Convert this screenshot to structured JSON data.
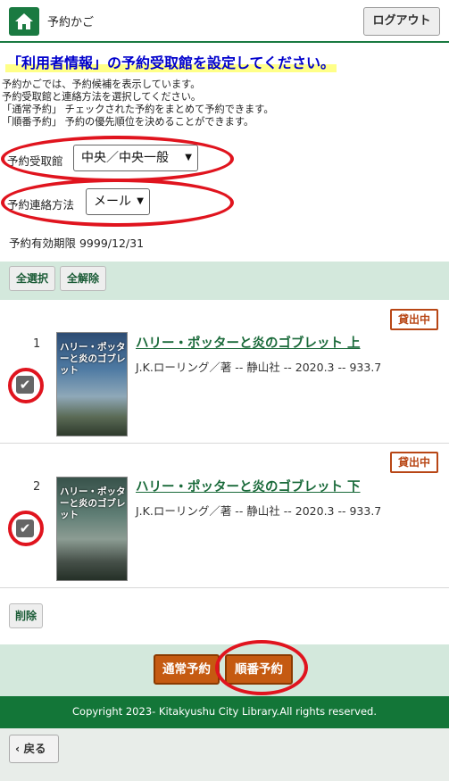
{
  "header": {
    "title": "予約かご",
    "logout_label": "ログアウト",
    "home_icon": "home-icon"
  },
  "notice": "「利用者情報」の予約受取館を設定してください。",
  "help_lines": [
    "予約かごでは、予約候補を表示しています。",
    "予約受取館と連絡方法を選択してください。",
    "「通常予約」 チェックされた予約をまとめて予約できます。",
    "「順番予約」 予約の優先順位を決めることができます。"
  ],
  "form": {
    "pickup_label": "予約受取館",
    "pickup_value": "中央／中央一般",
    "contact_label": "予約連絡方法",
    "contact_value": "メール",
    "expiry": "予約有効期限 9999/12/31"
  },
  "selection": {
    "select_all": "全選択",
    "deselect_all": "全解除"
  },
  "items": [
    {
      "num": "1",
      "title": "ハリー・ポッターと炎のゴブレット 上",
      "meta": "J.K.ローリング／著 -- 静山社 -- 2020.3 -- 933.7",
      "status": "貸出中",
      "checked": true,
      "cover_text": "ハリー・ポッターと炎のゴブレット"
    },
    {
      "num": "2",
      "title": "ハリー・ポッターと炎のゴブレット 下",
      "meta": "J.K.ローリング／著 -- 静山社 -- 2020.3 -- 933.7",
      "status": "貸出中",
      "checked": true,
      "cover_text": "ハリー・ポッターと炎のゴブレット"
    }
  ],
  "delete_label": "削除",
  "actions": {
    "normal_label": "通常予約",
    "order_label": "順番予約"
  },
  "footer": "Copyright 2023- Kitakyushu City Library.All rights reserved.",
  "back_label": "戻る",
  "colors": {
    "brand_green": "#1a7a41",
    "accent_orange": "#c55a11",
    "highlight_red": "#e0141e",
    "notice_blue": "#0000cc"
  }
}
